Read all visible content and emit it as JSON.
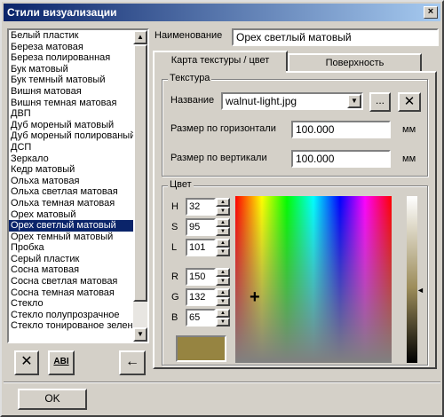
{
  "window": {
    "title": "Стили визуализации",
    "close_glyph": "×"
  },
  "styles_list": {
    "items": [
      "Белый пластик",
      "Береза матовая",
      "Береза полированная",
      "Бук матовый",
      "Бук темный матовый",
      "Вишня матовая",
      "Вишня темная матовая",
      "ДВП",
      "Дуб мореный матовый",
      "Дуб мореный полированый",
      "ДСП",
      "Зеркало",
      "Кедр матовый",
      "Ольха матовая",
      "Ольха светлая матовая",
      "Ольха темная матовая",
      "Орех матовый",
      "Орех светлый матовый",
      "Орех темный матовый",
      "Пробка",
      "Серый пластик",
      "Сосна матовая",
      "Сосна светлая матовая",
      "Сосна темная матовая",
      "Стекло",
      "Стекло полупрозрачное",
      "Стекло тонированое зелен"
    ],
    "selected_index": 17
  },
  "name_label": "Наименование",
  "name_value": "Орех светлый матовый",
  "tabs": [
    {
      "label": "Карта текстуры / цвет",
      "active": true
    },
    {
      "label": "Поверхность",
      "active": false
    }
  ],
  "texture": {
    "group_title": "Текстура",
    "name_label": "Название",
    "file_value": "walnut-light.jpg",
    "browse_label": "...",
    "delete_glyph": "✕",
    "horizontal_label": "Размер по горизонтали",
    "horizontal_value": "100.000",
    "vertical_label": "Размер по вертикали",
    "vertical_value": "100.000",
    "unit": "мм"
  },
  "color": {
    "group_title": "Цвет",
    "H": {
      "label": "H",
      "value": "32"
    },
    "S": {
      "label": "S",
      "value": "95"
    },
    "L": {
      "label": "L",
      "value": "101"
    },
    "R": {
      "label": "R",
      "value": "150"
    },
    "G": {
      "label": "G",
      "value": "132"
    },
    "B": {
      "label": "B",
      "value": "65"
    },
    "swatch_hex": "#968441",
    "crosshair_glyph": "+",
    "arrow_glyph": "◄"
  },
  "list_buttons": {
    "delete_glyph": "✕",
    "rename_label": "ABI",
    "apply_glyph": "←"
  },
  "ok_label": "OK"
}
